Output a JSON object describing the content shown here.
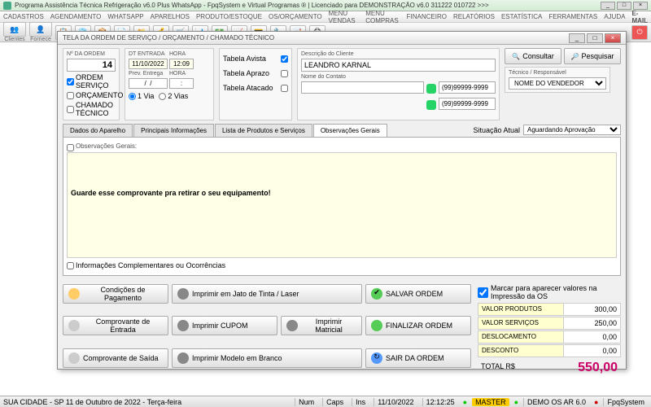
{
  "app": {
    "title": "Programa Assistência Técnica Refrigeração v6.0 Plus WhatsApp - FpqSystem e Virtual Programas ® | Licenciado para DEMONSTRAÇÃO v6.0 311222 010722 >>>"
  },
  "menu": [
    "CADASTROS",
    "AGENDAMENTO",
    "WHATSAPP",
    "APARELHOS",
    "PRODUTO/ESTOQUE",
    "OS/ORÇAMENTO",
    "MENU VENDAS",
    "MENU COMPRAS",
    "FINANCEIRO",
    "RELATÓRIOS",
    "ESTATÍSTICA",
    "FERRAMENTAS",
    "AJUDA"
  ],
  "menu_email": "E-MAIL",
  "toolbar_labels": {
    "clientes": "Clientes",
    "fornece": "Fornece"
  },
  "dialog": {
    "title": "TELA DA ORDEM DE SERVIÇO / ORÇAMENTO / CHAMADO TÉCNICO",
    "ordem": {
      "label": "Nº DA ORDEM",
      "value": "14"
    },
    "tipos": {
      "ordem_servico": "ORDEM SERVIÇO",
      "orcamento": "ORÇAMENTO",
      "chamado": "CHAMADO TÉCNICO"
    },
    "dt": {
      "entrada_lbl": "DT ENTRADA",
      "hora_lbl": "HORA",
      "entrada": "11/10/2022",
      "hora": "12:09",
      "prev_lbl": "Prev. Entrega",
      "prev_date": "/  /",
      "prev_hora": ":",
      "via1": "1 Via",
      "via2": "2 Vias"
    },
    "tabela": {
      "avista": "Tabela Avista",
      "aprazo": "Tabela Aprazo",
      "atacado": "Tabela Atacado"
    },
    "cliente": {
      "desc_lbl": "Descrição do Cliente",
      "nome": "LEANDRO KARNAL",
      "contato_lbl": "Nome do Contato",
      "contato": "",
      "tel1": "(99)99999-9999",
      "tel2": "(99)99999-9999"
    },
    "buttons": {
      "consultar": "Consultar",
      "pesquisar": "Pesquisar"
    },
    "tecnico": {
      "label": "Técnico / Responsável",
      "value": "NOME DO VENDEDOR"
    },
    "tabs": [
      "Dados do Aparelho",
      "Principais Informações",
      "Lista de Produtos e Serviços",
      "Observações Gerais"
    ],
    "situacao": {
      "label": "Situação Atual",
      "value": "Aguardando Aprovação"
    },
    "obs": {
      "title": "Observações Gerais:",
      "text": "Guarde esse comprovante pra retirar o seu equipamento!",
      "compl": "Informações Complementares ou Ocorrências"
    },
    "bottom_buttons": {
      "condicoes": "Condições de Pagamento",
      "imp_jato": "Imprimir em Jato de Tinta / Laser",
      "salvar": "SALVAR ORDEM",
      "comp_entrada": "Comprovante de Entrada",
      "imp_cupom": "Imprimir CUPOM",
      "imp_matricial": "Imprimir Matricial",
      "finalizar": "FINALIZAR ORDEM",
      "comp_saida": "Comprovante de Saída",
      "imp_branco": "Imprimir Modelo em Branco",
      "sair": "SAIR DA ORDEM"
    },
    "totals": {
      "marcar": "Marcar para aparecer valores na Impressão da OS",
      "produtos_lbl": "VALOR PRODUTOS",
      "produtos": "300,00",
      "servicos_lbl": "VALOR SERVIÇOS",
      "servicos": "250,00",
      "desloc_lbl": "DESLOCAMENTO",
      "desloc": "0,00",
      "desconto_lbl": "DESCONTO",
      "desconto": "0,00",
      "total_lbl": "TOTAL R$",
      "total": "550,00"
    }
  },
  "status": {
    "left": "SUA CIDADE - SP 11 de Outubro de 2022 - Terça-feira",
    "num": "Num",
    "caps": "Caps",
    "ins": "Ins",
    "date": "11/10/2022",
    "time": "12:12:25",
    "master": "MASTER",
    "demo": "DEMO OS AR 6.0",
    "sys": "FpqSystem"
  }
}
